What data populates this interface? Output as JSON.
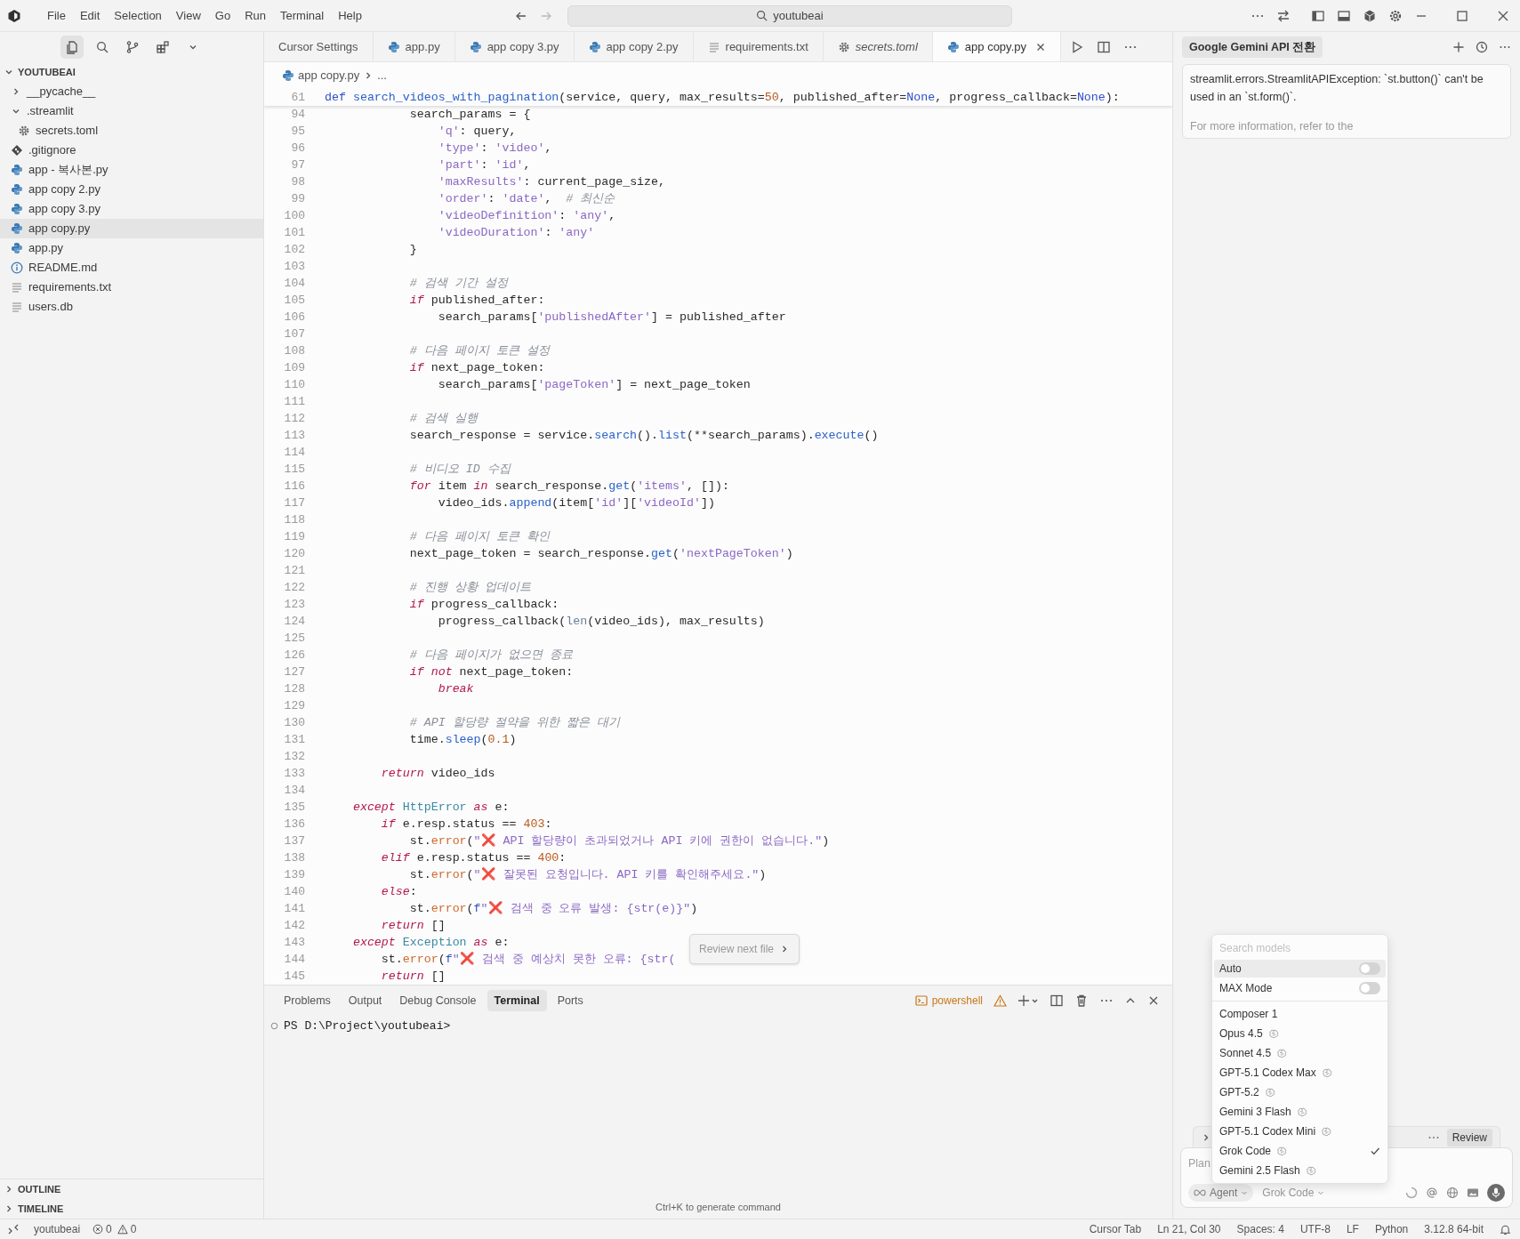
{
  "title_bar": {
    "menu": [
      "File",
      "Edit",
      "Selection",
      "View",
      "Go",
      "Run",
      "Terminal",
      "Help"
    ],
    "search": "youtubeai"
  },
  "activity_bar": [
    {
      "kind": "files",
      "selected": true
    },
    {
      "kind": "search",
      "selected": false
    },
    {
      "kind": "branch",
      "selected": false
    },
    {
      "kind": "extensions",
      "selected": false
    },
    {
      "kind": "chevron",
      "selected": false
    }
  ],
  "explorer": {
    "label": "YOUTUBEAI",
    "expanded": true,
    "items": [
      {
        "label": "__pycache__",
        "kind": "folder",
        "expanded": false,
        "selected": false
      },
      {
        "label": ".streamlit",
        "kind": "folder",
        "expanded": true,
        "selected": false,
        "children": [
          {
            "label": "secrets.toml",
            "kind": "gear",
            "selected": false
          }
        ]
      },
      {
        "label": ".gitignore",
        "kind": "git",
        "selected": false
      },
      {
        "label": "app - 복사본.py",
        "kind": "python",
        "selected": false
      },
      {
        "label": "app copy 2.py",
        "kind": "python",
        "selected": false
      },
      {
        "label": "app copy 3.py",
        "kind": "python",
        "selected": false
      },
      {
        "label": "app copy.py",
        "kind": "python",
        "selected": true
      },
      {
        "label": "app.py",
        "kind": "python",
        "selected": false
      },
      {
        "label": "README.md",
        "kind": "info",
        "selected": false
      },
      {
        "label": "requirements.txt",
        "kind": "lines",
        "selected": false
      },
      {
        "label": "users.db",
        "kind": "lines",
        "selected": false
      }
    ]
  },
  "bottom_sections": [
    {
      "label": "OUTLINE",
      "expanded": false
    },
    {
      "label": "TIMELINE",
      "expanded": false
    }
  ],
  "tabs": [
    {
      "label": "Cursor Settings",
      "kind": "none",
      "italic": false,
      "selected": false
    },
    {
      "label": "app.py",
      "kind": "python",
      "italic": false,
      "selected": false
    },
    {
      "label": "app copy 3.py",
      "kind": "python",
      "italic": false,
      "selected": false
    },
    {
      "label": "app copy 2.py",
      "kind": "python",
      "italic": false,
      "selected": false
    },
    {
      "label": "requirements.txt",
      "kind": "lines",
      "italic": false,
      "selected": false
    },
    {
      "label": "secrets.toml",
      "kind": "gear",
      "italic": true,
      "selected": false
    },
    {
      "label": "app copy.py",
      "kind": "python",
      "italic": false,
      "selected": true
    }
  ],
  "breadcrumb": {
    "file": "app copy.py",
    "rest": "..."
  },
  "code": {
    "sticky": {
      "number": "61",
      "segments": [
        {
          "text": "def",
          "kind": "storage"
        },
        {
          "text": " search_videos_with_pagination",
          "kind": "function"
        },
        {
          "text": "(service, query, max_results=",
          "kind": "plain"
        },
        {
          "text": "50",
          "kind": "number"
        },
        {
          "text": ", published_after=",
          "kind": "plain"
        },
        {
          "text": "None",
          "kind": "constant"
        },
        {
          "text": ", progress_callback=",
          "kind": "plain"
        },
        {
          "text": "None",
          "kind": "constant"
        },
        {
          "text": "):",
          "kind": "plain"
        }
      ]
    },
    "lines": [
      {
        "number": "94",
        "segments": [
          {
            "text": "            search_params = {",
            "kind": "plain"
          }
        ]
      },
      {
        "number": "95",
        "segments": [
          {
            "text": "                'q'",
            "kind": "string"
          },
          {
            "text": ": query,",
            "kind": "plain"
          }
        ]
      },
      {
        "number": "96",
        "segments": [
          {
            "text": "                'type'",
            "kind": "string"
          },
          {
            "text": ": ",
            "kind": "plain"
          },
          {
            "text": "'video'",
            "kind": "string"
          },
          {
            "text": ",",
            "kind": "plain"
          }
        ]
      },
      {
        "number": "97",
        "segments": [
          {
            "text": "                'part'",
            "kind": "string"
          },
          {
            "text": ": ",
            "kind": "plain"
          },
          {
            "text": "'id'",
            "kind": "string"
          },
          {
            "text": ",",
            "kind": "plain"
          }
        ]
      },
      {
        "number": "98",
        "segments": [
          {
            "text": "                'maxResults'",
            "kind": "string"
          },
          {
            "text": ": current_page_size,",
            "kind": "plain"
          }
        ]
      },
      {
        "number": "99",
        "segments": [
          {
            "text": "                'order'",
            "kind": "string"
          },
          {
            "text": ": ",
            "kind": "plain"
          },
          {
            "text": "'date'",
            "kind": "string"
          },
          {
            "text": ",",
            "kind": "plain"
          },
          {
            "text": "  # 최신순",
            "kind": "comment"
          }
        ]
      },
      {
        "number": "100",
        "segments": [
          {
            "text": "                'videoDefinition'",
            "kind": "string"
          },
          {
            "text": ": ",
            "kind": "plain"
          },
          {
            "text": "'any'",
            "kind": "string"
          },
          {
            "text": ",",
            "kind": "plain"
          }
        ]
      },
      {
        "number": "101",
        "segments": [
          {
            "text": "                'videoDuration'",
            "kind": "string"
          },
          {
            "text": ": ",
            "kind": "plain"
          },
          {
            "text": "'any'",
            "kind": "string"
          }
        ]
      },
      {
        "number": "102",
        "segments": [
          {
            "text": "            }",
            "kind": "plain"
          }
        ]
      },
      {
        "number": "103"
      },
      {
        "number": "104",
        "segments": [
          {
            "text": "            # 검색 기간 설정",
            "kind": "comment"
          }
        ]
      },
      {
        "number": "105",
        "segments": [
          {
            "text": "            if",
            "kind": "keyword"
          },
          {
            "text": " published_after:",
            "kind": "plain"
          }
        ]
      },
      {
        "number": "106",
        "segments": [
          {
            "text": "                search_params[",
            "kind": "plain"
          },
          {
            "text": "'publishedAfter'",
            "kind": "string"
          },
          {
            "text": "] = published_after",
            "kind": "plain"
          }
        ]
      },
      {
        "number": "107"
      },
      {
        "number": "108",
        "segments": [
          {
            "text": "            # 다음 페이지 토큰 설정",
            "kind": "comment"
          }
        ]
      },
      {
        "number": "109",
        "segments": [
          {
            "text": "            if",
            "kind": "keyword"
          },
          {
            "text": " next_page_token:",
            "kind": "plain"
          }
        ]
      },
      {
        "number": "110",
        "segments": [
          {
            "text": "                search_params[",
            "kind": "plain"
          },
          {
            "text": "'pageToken'",
            "kind": "string"
          },
          {
            "text": "] = next_page_token",
            "kind": "plain"
          }
        ]
      },
      {
        "number": "111"
      },
      {
        "number": "112",
        "segments": [
          {
            "text": "            # 검색 실행",
            "kind": "comment"
          }
        ]
      },
      {
        "number": "113",
        "segments": [
          {
            "text": "            search_response = service.",
            "kind": "plain"
          },
          {
            "text": "search",
            "kind": "method"
          },
          {
            "text": "().",
            "kind": "plain"
          },
          {
            "text": "list",
            "kind": "method"
          },
          {
            "text": "(**search_params).",
            "kind": "plain"
          },
          {
            "text": "execute",
            "kind": "method"
          },
          {
            "text": "()",
            "kind": "plain"
          }
        ]
      },
      {
        "number": "114"
      },
      {
        "number": "115",
        "segments": [
          {
            "text": "            # 비디오 ID 수집",
            "kind": "comment"
          }
        ]
      },
      {
        "number": "116",
        "segments": [
          {
            "text": "            for",
            "kind": "keyword"
          },
          {
            "text": " item ",
            "kind": "plain"
          },
          {
            "text": "in",
            "kind": "keyword"
          },
          {
            "text": " search_response.",
            "kind": "plain"
          },
          {
            "text": "get",
            "kind": "method"
          },
          {
            "text": "(",
            "kind": "plain"
          },
          {
            "text": "'items'",
            "kind": "string"
          },
          {
            "text": ", []):",
            "kind": "plain"
          }
        ]
      },
      {
        "number": "117",
        "segments": [
          {
            "text": "                video_ids.",
            "kind": "plain"
          },
          {
            "text": "append",
            "kind": "method"
          },
          {
            "text": "(item[",
            "kind": "plain"
          },
          {
            "text": "'id'",
            "kind": "string"
          },
          {
            "text": "][",
            "kind": "plain"
          },
          {
            "text": "'videoId'",
            "kind": "string"
          },
          {
            "text": "])",
            "kind": "plain"
          }
        ]
      },
      {
        "number": "118"
      },
      {
        "number": "119",
        "segments": [
          {
            "text": "            # 다음 페이지 토큰 확인",
            "kind": "comment"
          }
        ]
      },
      {
        "number": "120",
        "segments": [
          {
            "text": "            next_page_token = search_response.",
            "kind": "plain"
          },
          {
            "text": "get",
            "kind": "method"
          },
          {
            "text": "(",
            "kind": "plain"
          },
          {
            "text": "'nextPageToken'",
            "kind": "string"
          },
          {
            "text": ")",
            "kind": "plain"
          }
        ]
      },
      {
        "number": "121"
      },
      {
        "number": "122",
        "segments": [
          {
            "text": "            # 진행 상황 업데이트",
            "kind": "comment"
          }
        ]
      },
      {
        "number": "123",
        "segments": [
          {
            "text": "            if",
            "kind": "keyword"
          },
          {
            "text": " progress_callback:",
            "kind": "plain"
          }
        ]
      },
      {
        "number": "124",
        "segments": [
          {
            "text": "                progress_callback(",
            "kind": "plain"
          },
          {
            "text": "len",
            "kind": "builtin"
          },
          {
            "text": "(video_ids), max_results)",
            "kind": "plain"
          }
        ]
      },
      {
        "number": "125"
      },
      {
        "number": "126",
        "segments": [
          {
            "text": "            # 다음 페이지가 없으면 종료",
            "kind": "comment"
          }
        ]
      },
      {
        "number": "127",
        "segments": [
          {
            "text": "            if not",
            "kind": "keyword"
          },
          {
            "text": " next_page_token:",
            "kind": "plain"
          }
        ]
      },
      {
        "number": "128",
        "segments": [
          {
            "text": "                break",
            "kind": "keyword"
          }
        ]
      },
      {
        "number": "129"
      },
      {
        "number": "130",
        "segments": [
          {
            "text": "            # API 할당량 절약을 위한 짧은 대기",
            "kind": "comment"
          }
        ]
      },
      {
        "number": "131",
        "segments": [
          {
            "text": "            time.",
            "kind": "plain"
          },
          {
            "text": "sleep",
            "kind": "method"
          },
          {
            "text": "(",
            "kind": "plain"
          },
          {
            "text": "0.1",
            "kind": "number"
          },
          {
            "text": ")",
            "kind": "plain"
          }
        ]
      },
      {
        "number": "132"
      },
      {
        "number": "133",
        "segments": [
          {
            "text": "        return",
            "kind": "keyword"
          },
          {
            "text": " video_ids",
            "kind": "plain"
          }
        ]
      },
      {
        "number": "134"
      },
      {
        "number": "135",
        "segments": [
          {
            "text": "    except",
            "kind": "keyword"
          },
          {
            "text": " HttpError",
            "kind": "type"
          },
          {
            "text": " as",
            "kind": "keyword"
          },
          {
            "text": " e:",
            "kind": "plain"
          }
        ]
      },
      {
        "number": "136",
        "segments": [
          {
            "text": "        if",
            "kind": "keyword"
          },
          {
            "text": " e.resp.status == ",
            "kind": "plain"
          },
          {
            "text": "403",
            "kind": "number"
          },
          {
            "text": ":",
            "kind": "plain"
          }
        ]
      },
      {
        "number": "137",
        "segments": [
          {
            "text": "            st.",
            "kind": "plain"
          },
          {
            "text": "error",
            "kind": "call"
          },
          {
            "text": "(",
            "kind": "plain"
          },
          {
            "text": "\"❌ API 할당량이 초과되었거나 API 키에 권한이 없습니다.\"",
            "kind": "string"
          },
          {
            "text": ")",
            "kind": "plain"
          }
        ]
      },
      {
        "number": "138",
        "segments": [
          {
            "text": "        elif",
            "kind": "keyword"
          },
          {
            "text": " e.resp.status == ",
            "kind": "plain"
          },
          {
            "text": "400",
            "kind": "number"
          },
          {
            "text": ":",
            "kind": "plain"
          }
        ]
      },
      {
        "number": "139",
        "segments": [
          {
            "text": "            st.",
            "kind": "plain"
          },
          {
            "text": "error",
            "kind": "call"
          },
          {
            "text": "(",
            "kind": "plain"
          },
          {
            "text": "\"❌ 잘못된 요청입니다. API 키를 확인해주세요.\"",
            "kind": "string"
          },
          {
            "text": ")",
            "kind": "plain"
          }
        ]
      },
      {
        "number": "140",
        "segments": [
          {
            "text": "        else",
            "kind": "keyword"
          },
          {
            "text": ":",
            "kind": "plain"
          }
        ]
      },
      {
        "number": "141",
        "segments": [
          {
            "text": "            st.",
            "kind": "plain"
          },
          {
            "text": "error",
            "kind": "call"
          },
          {
            "text": "(",
            "kind": "plain"
          },
          {
            "text": "f",
            "kind": "storage"
          },
          {
            "text": "\"❌ 검색 중 오류 발생: {str(e)}\"",
            "kind": "string"
          },
          {
            "text": ")",
            "kind": "plain"
          }
        ]
      },
      {
        "number": "142",
        "segments": [
          {
            "text": "        return",
            "kind": "keyword"
          },
          {
            "text": " []",
            "kind": "plain"
          }
        ]
      },
      {
        "number": "143",
        "segments": [
          {
            "text": "    except",
            "kind": "keyword"
          },
          {
            "text": " Exception",
            "kind": "type"
          },
          {
            "text": " as",
            "kind": "keyword"
          },
          {
            "text": " e:",
            "kind": "plain"
          }
        ]
      },
      {
        "number": "144",
        "segments": [
          {
            "text": "        st.",
            "kind": "plain"
          },
          {
            "text": "error",
            "kind": "call"
          },
          {
            "text": "(",
            "kind": "plain"
          },
          {
            "text": "f",
            "kind": "storage"
          },
          {
            "text": "\"❌ 검색 중 예상치 못한 오류: {str(",
            "kind": "string"
          }
        ]
      },
      {
        "number": "145",
        "segments": [
          {
            "text": "        return",
            "kind": "keyword"
          },
          {
            "text": " []",
            "kind": "plain"
          }
        ]
      }
    ]
  },
  "review_popup": {
    "label": "Review next file"
  },
  "panel": {
    "tabs": [
      {
        "label": "Problems",
        "selected": false
      },
      {
        "label": "Output",
        "selected": false
      },
      {
        "label": "Debug Console",
        "selected": false
      },
      {
        "label": "Terminal",
        "selected": true
      },
      {
        "label": "Ports",
        "selected": false
      }
    ],
    "shell": "powershell",
    "prompt": "PS D:\\Project\\youtubeai>",
    "hint": "Ctrl+K to generate command"
  },
  "chat": {
    "title": "Google Gemini API 전환",
    "message": [
      "streamlit.errors.StreamlitAPIException: `st.button()` can't be used in an `st.form()`.",
      "For more information, refer to the"
    ],
    "review_button": "Review",
    "placeholder": "Plan",
    "mode": "Agent",
    "model": "Grok Code"
  },
  "model_menu": {
    "placeholder": "Search models",
    "toggles": [
      {
        "label": "Auto",
        "on": false,
        "highlighted": true
      },
      {
        "label": "MAX Mode",
        "on": false,
        "highlighted": false
      }
    ],
    "models": [
      {
        "label": "Composer 1",
        "thinking": false,
        "selected": false
      },
      {
        "label": "Opus 4.5",
        "thinking": true,
        "selected": false
      },
      {
        "label": "Sonnet 4.5",
        "thinking": true,
        "selected": false
      },
      {
        "label": "GPT-5.1 Codex Max",
        "thinking": true,
        "selected": false
      },
      {
        "label": "GPT-5.2",
        "thinking": true,
        "selected": false
      },
      {
        "label": "Gemini 3 Flash",
        "thinking": true,
        "selected": false
      },
      {
        "label": "GPT-5.1 Codex Mini",
        "thinking": true,
        "selected": false
      },
      {
        "label": "Grok Code",
        "thinking": true,
        "selected": true
      },
      {
        "label": "Gemini 2.5 Flash",
        "thinking": true,
        "selected": false
      }
    ]
  },
  "status_bar": {
    "workspace": "youtubeai",
    "errors": "0",
    "warnings": "0",
    "items": [
      "Cursor Tab",
      "Ln 21, Col 30",
      "Spaces: 4",
      "UTF-8",
      "LF",
      "Python",
      "3.12.8 64-bit"
    ]
  }
}
